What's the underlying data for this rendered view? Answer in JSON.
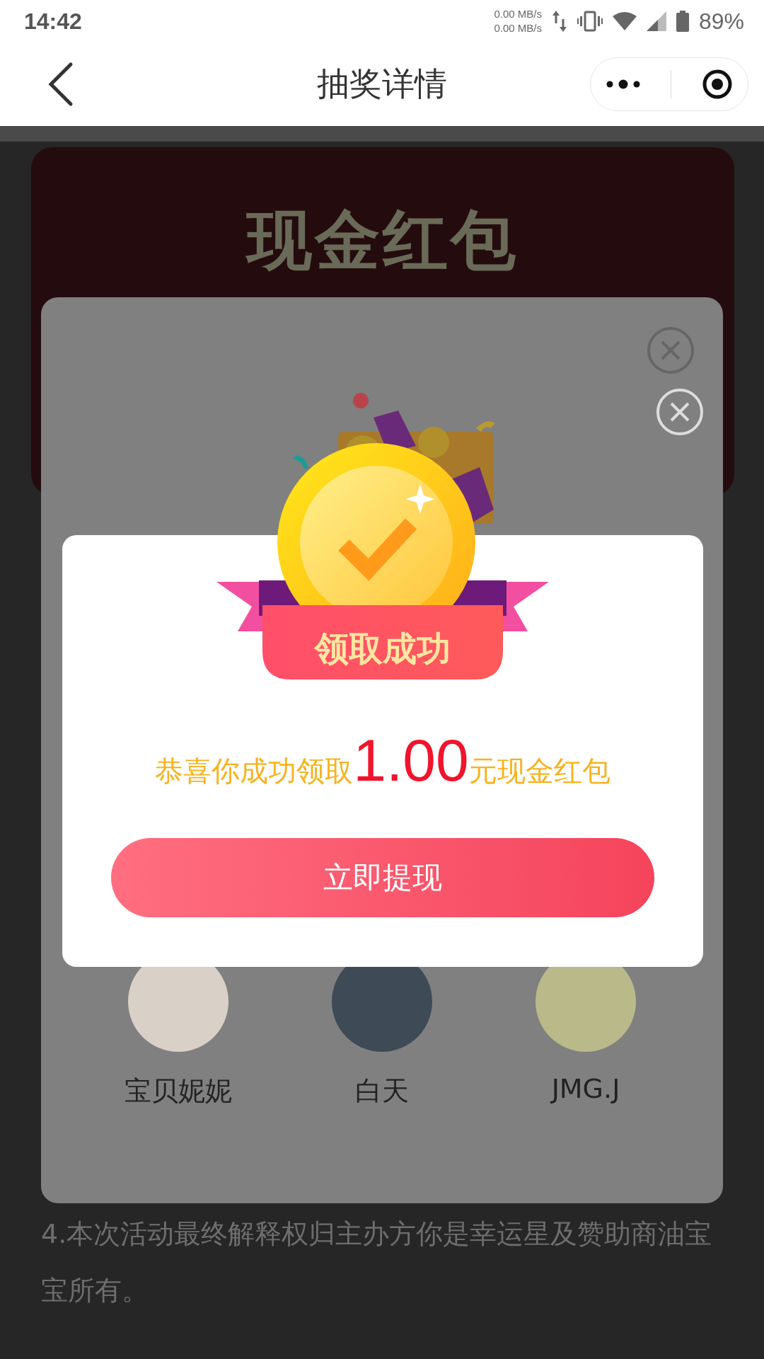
{
  "status_bar": {
    "time": "14:42",
    "net_up": "0.00 MB/s",
    "net_down": "0.00 MB/s",
    "battery": "89%"
  },
  "nav": {
    "title": "抽奖详情"
  },
  "card": {
    "title": "现金红包"
  },
  "winners": [
    {
      "name": "宝贝妮妮"
    },
    {
      "name": "白天"
    },
    {
      "name": "JMG.J"
    }
  ],
  "dialog": {
    "badge": "领取成功",
    "message_before": "恭喜你成功领取",
    "amount": "1.00",
    "message_after": "元现金红包",
    "button": "立即提现"
  },
  "rules": [
    "4.本次活动最终解释权归主办方你是幸运星及赞助商油宝宝所有。"
  ]
}
